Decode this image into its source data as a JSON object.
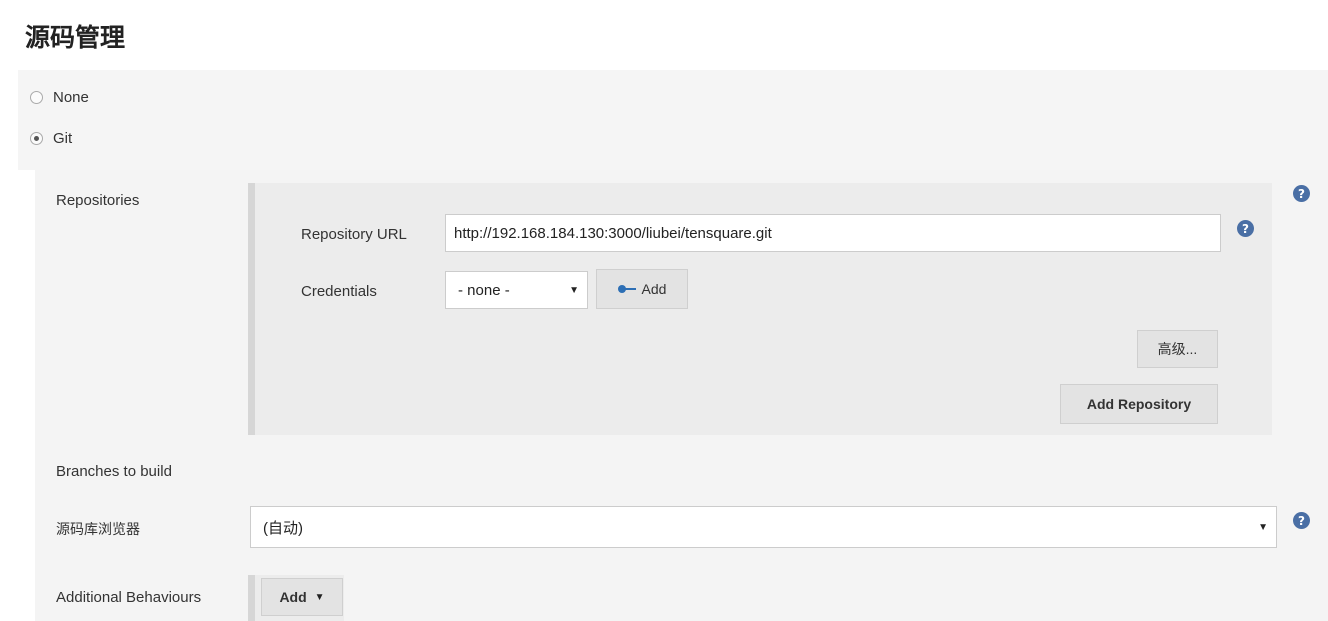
{
  "section_title": "源码管理",
  "scm_options": [
    {
      "label": "None",
      "selected": false
    },
    {
      "label": "Git",
      "selected": true
    }
  ],
  "repositories": {
    "label": "Repositories",
    "repo_url_label": "Repository URL",
    "repo_url_value": "http://192.168.184.130:3000/liubei/tensquare.git",
    "credentials_label": "Credentials",
    "credentials_value": "- none -",
    "add_button": "Add",
    "advanced_button": "高级...",
    "add_repository_button": "Add Repository"
  },
  "branches_label": "Branches to build",
  "repo_browser": {
    "label": "源码库浏览器",
    "value": "(自动)"
  },
  "additional_behaviours": {
    "label": "Additional Behaviours",
    "add_button": "Add"
  },
  "icons": {
    "help": "?",
    "caret": "▼"
  },
  "colors": {
    "help_icon": "#4a6fa5",
    "panel_bg": "#f4f4f4",
    "repo_box_bg": "#ececec"
  }
}
